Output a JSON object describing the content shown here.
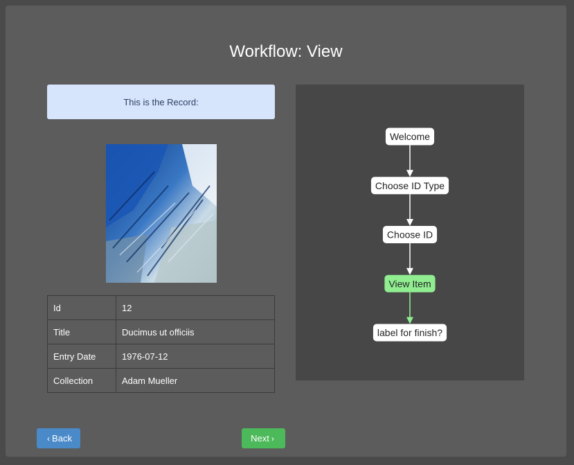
{
  "page": {
    "title": "Workflow: View"
  },
  "record": {
    "header": "This is the Record:",
    "fields": [
      {
        "key": "Id",
        "value": "12"
      },
      {
        "key": "Title",
        "value": "Ducimus ut officiis"
      },
      {
        "key": "Entry Date",
        "value": "1976-07-12"
      },
      {
        "key": "Collection",
        "value": "Adam Mueller"
      }
    ]
  },
  "workflow": {
    "nodes": [
      {
        "label": "Welcome",
        "active": false
      },
      {
        "label": "Choose ID Type",
        "active": false
      },
      {
        "label": "Choose ID",
        "active": false
      },
      {
        "label": "View Item",
        "active": true
      },
      {
        "label": "label for finish?",
        "active": false
      }
    ],
    "colors": {
      "active_fill": "#90ee90",
      "node_fill": "#ffffff",
      "edge": "#ffffff",
      "active_edge": "#90ee90"
    }
  },
  "buttons": {
    "back": {
      "label": "Back",
      "icon": "chevron-left-icon"
    },
    "next": {
      "label": "Next",
      "icon": "chevron-right-icon"
    }
  }
}
